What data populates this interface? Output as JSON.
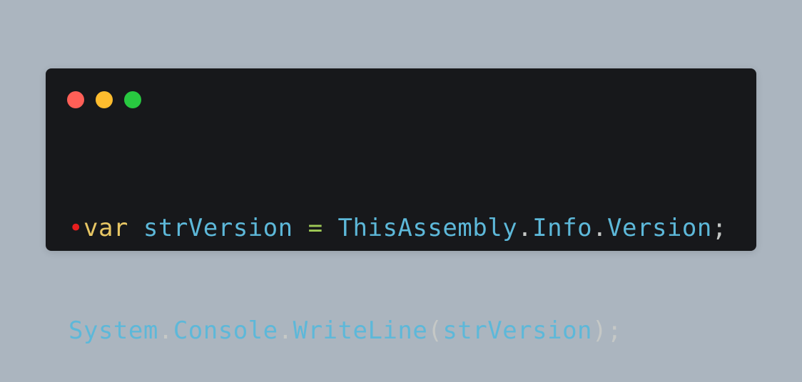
{
  "window": {
    "controls": [
      {
        "name": "close",
        "color": "#ff5f57"
      },
      {
        "name": "minimize",
        "color": "#febc2e"
      },
      {
        "name": "maximize",
        "color": "#28c840"
      }
    ]
  },
  "code": {
    "line1": {
      "marker": "•",
      "keyword": "var",
      "space1": " ",
      "variable": "strVersion",
      "space2": " ",
      "operator": "=",
      "space3": " ",
      "class": "ThisAssembly",
      "dot1": ".",
      "member1": "Info",
      "dot2": ".",
      "member2": "Version",
      "semicolon": ";"
    },
    "line2": {
      "namespace": "System",
      "dot1": ".",
      "class": "Console",
      "dot2": ".",
      "method": "WriteLine",
      "open_paren": "(",
      "argument": "strVersion",
      "close_paren": ")",
      "semicolon": ";"
    }
  },
  "colors": {
    "background": "#abb5bf",
    "window": "#17181b",
    "keyword": "#e7c664",
    "identifier": "#5db8d9",
    "operator": "#9fca56",
    "punctuation": "#c5c8c6",
    "marker": "#e81e1e"
  }
}
